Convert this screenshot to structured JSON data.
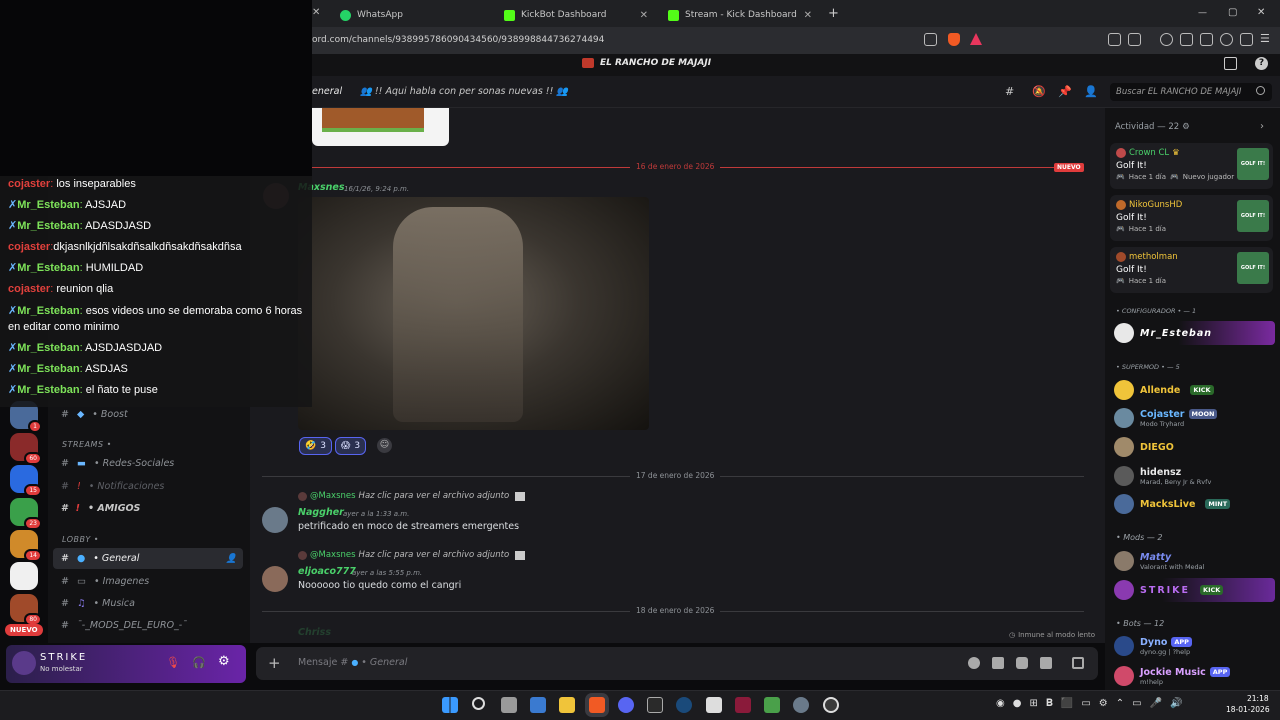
{
  "browser": {
    "tabs": [
      {
        "label": "WhatsApp",
        "color": "#25d366"
      },
      {
        "label": "KickBot Dashboard",
        "color": "#53fc18"
      },
      {
        "label": "Stream - Kick Dashboard",
        "color": "#53fc18"
      }
    ],
    "new_tab": "+",
    "url": "ord.com/channels/938995786090434560/938998844736274494",
    "window_controls": [
      "—",
      "▢",
      "✕"
    ]
  },
  "server": {
    "title": "EL RANCHO DE MAJAJI"
  },
  "channel_header": {
    "name": "eneral",
    "topic": "!! Aqui habla con per sonas nuevas !!",
    "search_placeholder": "Buscar EL RANCHO DE MAJAJI"
  },
  "stream_chat": [
    {
      "user": "cojaster",
      "text": "los inseparables",
      "user_color": "#e0403c"
    },
    {
      "user": "Mr_Esteban",
      "text": "AJSJAD",
      "user_color": "#7ee35a"
    },
    {
      "user": "Mr_Esteban",
      "text": "ADASDJASD",
      "user_color": "#7ee35a"
    },
    {
      "user": "cojaster",
      "text": "dkjasnlkjdñlsakdñsalkdñsakdñsakdñsa",
      "user_color": "#e0403c"
    },
    {
      "user": "Mr_Esteban",
      "text": "HUMILDAD",
      "user_color": "#7ee35a"
    },
    {
      "user": "cojaster",
      "text": "reunion qlia",
      "user_color": "#e0403c"
    },
    {
      "user": "Mr_Esteban",
      "text": "esos videos uno se demoraba como 6 horas en editar como minimo",
      "user_color": "#7ee35a"
    },
    {
      "user": "Mr_Esteban",
      "text": "AJSDJASDJAD",
      "user_color": "#7ee35a"
    },
    {
      "user": "Mr_Esteban",
      "text": "ASDJAS",
      "user_color": "#7ee35a"
    },
    {
      "user": "Mr_Esteban",
      "text": "el ñato te puse",
      "user_color": "#7ee35a"
    }
  ],
  "sidebar": {
    "channels": [
      {
        "label": "• Boost"
      },
      {
        "category": "STREAMS •"
      },
      {
        "label": "• Redes-Sociales"
      },
      {
        "label": "• Notificaciones"
      },
      {
        "label": "• AMIGOS"
      },
      {
        "category": "LOBBY •"
      },
      {
        "label": "• General"
      },
      {
        "label": "• Imagenes"
      },
      {
        "label": "• Musica"
      },
      {
        "label": "¯-_MODS_DEL_EURO_-¯"
      }
    ],
    "guild_badges": [
      "1",
      "60",
      "15",
      "23",
      "14",
      "80"
    ],
    "new_label": "NUEVO",
    "user": {
      "name": "STRIKE",
      "status": "No molestar"
    }
  },
  "messages": {
    "divider_1": "16 de enero de 2026",
    "new_label": "NUEVO",
    "msg1": {
      "user": "Maxsnes",
      "time": "16/1/26, 9:24 p.m."
    },
    "reactions": [
      {
        "emoji": "🤣",
        "count": "3"
      },
      {
        "emoji": "😱",
        "count": "3"
      }
    ],
    "divider_2": "17 de enero de 2026",
    "msg2": {
      "reply_user": "@Maxsnes",
      "reply_text": "Haz clic para ver el archivo adjunto",
      "user": "Naggher",
      "time": "ayer a la 1:33 a.m.",
      "text": "petrificado en moco de streamers emergentes"
    },
    "msg3": {
      "reply_user": "@Maxsnes",
      "reply_text": "Haz clic para ver el archivo adjunto",
      "user": "eljoaco777",
      "time": "ayer a las 5:55 p.m.",
      "text": "Noooooo tio quedo como el cangri"
    },
    "divider_3": "18 de enero de 2026",
    "next_user": "Chriss",
    "slowmode": "Inmune al modo lento",
    "composer_placeholder": "Mensaje #",
    "composer_channel": "• General"
  },
  "members": {
    "activity_header": "Actividad — 22",
    "activity": [
      {
        "name": "Crown CL",
        "game": "Golf It!",
        "meta": "Hace 1 día",
        "extra": "Nuevo jugador"
      },
      {
        "name": "NikoGunsHD",
        "game": "Golf It!",
        "meta": "Hace 1 día",
        "extra": ""
      },
      {
        "name": "metholman",
        "game": "Golf It!",
        "meta": "Hace 1 día",
        "extra": ""
      }
    ],
    "game_thumb": "GOLF IT!",
    "groups": [
      {
        "title": "• CONFIGURADOR • — 1",
        "members": [
          {
            "name": "Mr_Esteban",
            "color": "#ffffff",
            "sub": "",
            "tag": ""
          }
        ]
      },
      {
        "title": "• SUPERMOD • — 5",
        "members": [
          {
            "name": "Allende",
            "color": "#f0c43a",
            "sub": "",
            "tag": "KICK"
          },
          {
            "name": "Cojaster",
            "color": "#6ab7ff",
            "sub": "Modo Tryhard",
            "tag": "MOON"
          },
          {
            "name": "DIEGO",
            "color": "#f0c43a",
            "sub": "",
            "tag": ""
          },
          {
            "name": "hidensz",
            "color": "#e8e8e8",
            "sub": "Marad, Beny Jr & Rvfv",
            "tag": ""
          },
          {
            "name": "MacksLive",
            "color": "#f0c43a",
            "sub": "",
            "tag": "MINT"
          }
        ]
      },
      {
        "title": "• Mods — 2",
        "members": [
          {
            "name": "Matty",
            "color": "#7a8cf0",
            "sub": "Valorant with Medal",
            "tag": ""
          },
          {
            "name": "STRIKE",
            "color": "#b86cf0",
            "sub": "",
            "tag": "KICK"
          }
        ]
      },
      {
        "title": "• Bots — 12",
        "members": [
          {
            "name": "Dyno",
            "color": "#8ab0ff",
            "sub": "dyno.gg | ?help",
            "tag": "APP"
          },
          {
            "name": "Jockie Music",
            "color": "#d9a0ff",
            "sub": "m!help",
            "tag": "APP"
          }
        ]
      }
    ]
  },
  "taskbar": {
    "time": "21:18",
    "date": "18-01-2026"
  }
}
